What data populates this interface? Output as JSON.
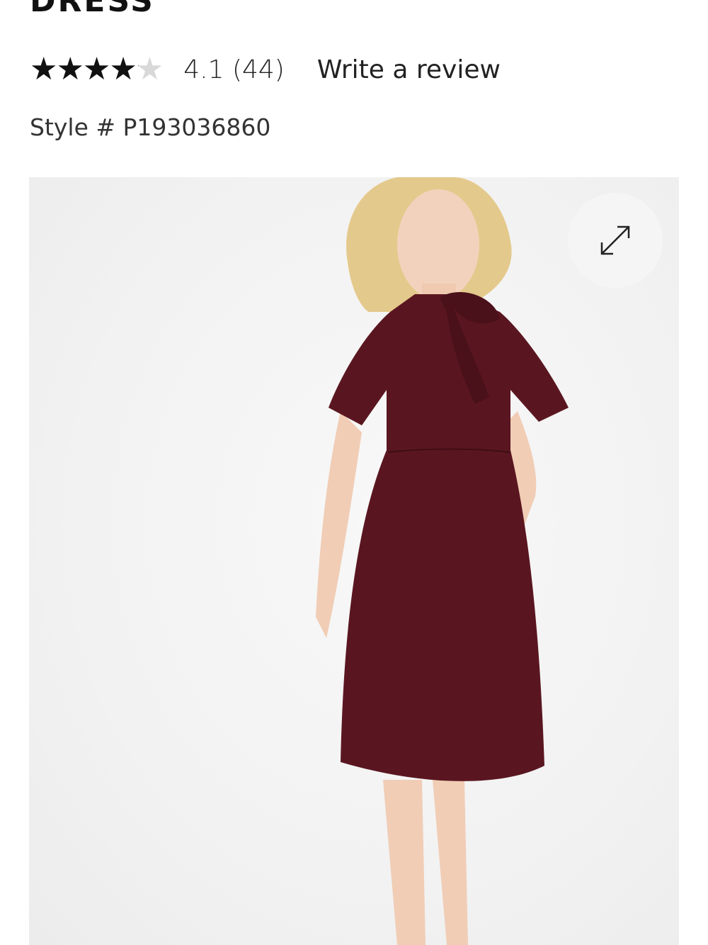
{
  "product": {
    "title": "DRESS",
    "rating": {
      "value": 4.1,
      "value_label": "4.1",
      "count_label": "(44)",
      "max": 5,
      "stars": "★★★★★"
    },
    "write_review_label": "Write a review",
    "style_label": "Style # P193036860"
  },
  "image": {
    "description_icon": "expand-icon",
    "dress_color": "#5a1620",
    "background_color": "#f2f2f2"
  }
}
